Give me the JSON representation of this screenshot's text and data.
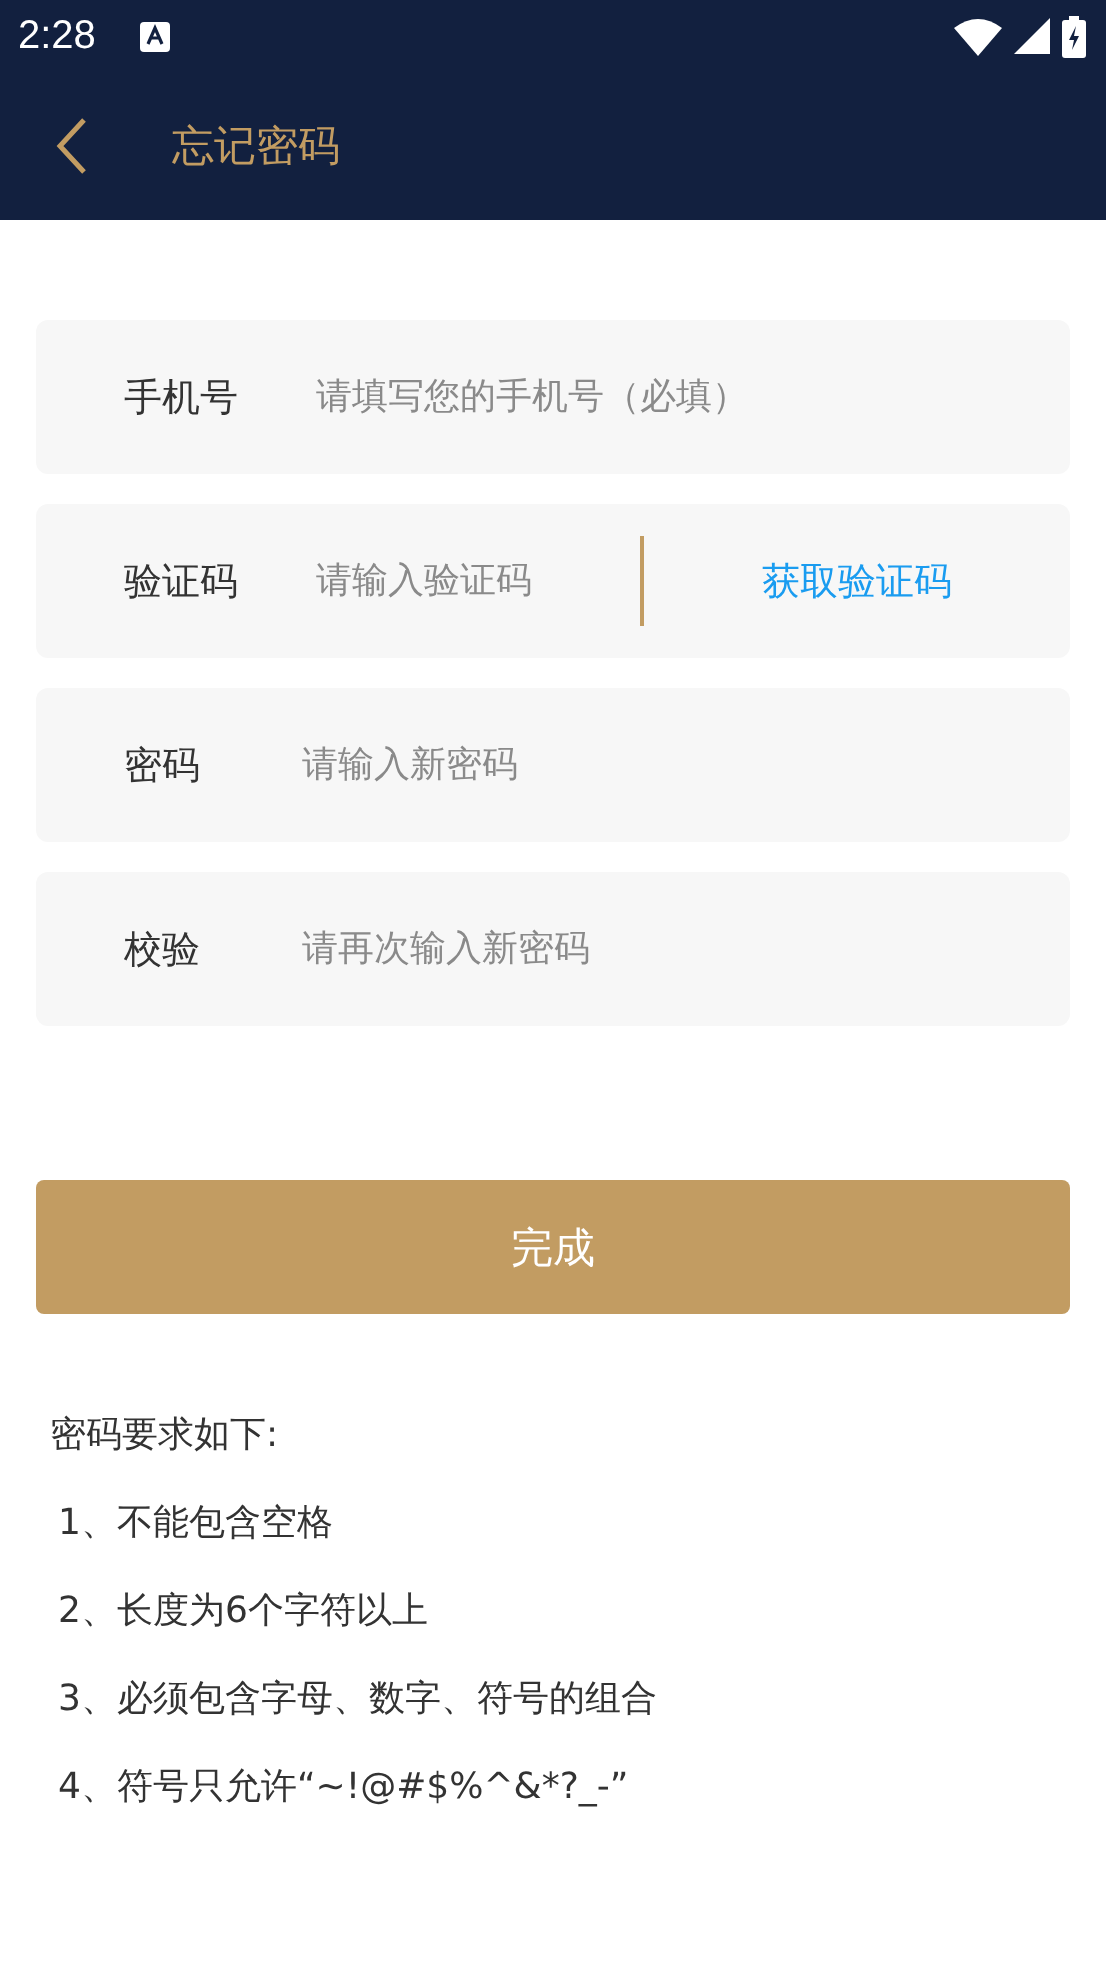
{
  "status_bar": {
    "time": "2:28"
  },
  "header": {
    "title": "忘记密码"
  },
  "fields": [
    {
      "kind": "text",
      "label": "手机号",
      "placeholder": "请填写您的手机号（必填）"
    },
    {
      "kind": "code",
      "label": "验证码",
      "placeholder": "请输入验证码",
      "action": "获取验证码"
    },
    {
      "kind": "text",
      "label": "密码",
      "placeholder": "请输入新密码"
    },
    {
      "kind": "text",
      "label": "校验",
      "placeholder": "请再次输入新密码"
    }
  ],
  "submit_button": "完成",
  "rules": {
    "title": "密码要求如下:",
    "items": [
      "1、不能包含空格",
      "2、长度为6个字符以上",
      "3、必须包含字母、数字、符号的组合",
      "4、符号只允许“~!@#$%^&*?_-”"
    ]
  }
}
